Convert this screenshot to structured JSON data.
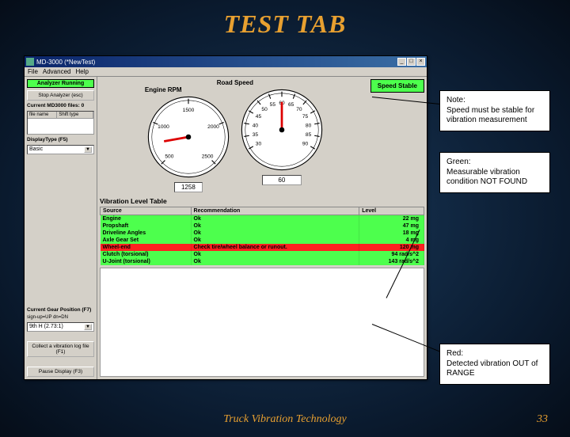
{
  "slide": {
    "title": "TEST TAB",
    "footer": "Truck Vibration Technology",
    "page": "33"
  },
  "window": {
    "title": "MD-3000 (*NewTest)",
    "menu": [
      "File",
      "Advanced",
      "Help"
    ],
    "winbtns": {
      "min": "_",
      "max": "□",
      "close": "×"
    }
  },
  "left": {
    "analyzer_status": "Analyzer Running",
    "stop_btn": "Stop Analyzer (esc)",
    "file_group": "Current MD3000 files: 0",
    "file_hdr_a": "file name",
    "file_hdr_b": "Shift type",
    "display_group": "DisplayType (F5)",
    "display_val": "Basic",
    "gear_group": "Current Gear Position (F7)",
    "gear_hint": "sign-up=UP dn=DN",
    "gear_val": "9th H (2.73:1)",
    "collect_btn": "Collect a vibration log file (F1)",
    "pause_btn": "Pause Display (F3)"
  },
  "gauges": {
    "road_speed_label": "Road Speed",
    "engine_rpm_label": "Engine RPM",
    "rpm_ticks": [
      "500",
      "1000",
      "1500",
      "2000",
      "2500"
    ],
    "speed_ticks": [
      "30",
      "35",
      "40",
      "45",
      "50",
      "55",
      "60",
      "65",
      "70",
      "75",
      "80",
      "85",
      "90"
    ],
    "rpm_value": "1258",
    "speed_value": "60",
    "speed_stable": "Speed Stable"
  },
  "table": {
    "title": "Vibration Level Table",
    "cols": [
      "Source",
      "Recommendation",
      "Level"
    ],
    "rows": [
      {
        "src": "Engine",
        "rec": "Ok",
        "lvl": "22 mg",
        "cls": "ok"
      },
      {
        "src": "Propshaft",
        "rec": "Ok",
        "lvl": "47 mg",
        "cls": "ok"
      },
      {
        "src": "Driveline Angles",
        "rec": "Ok",
        "lvl": "18 mg",
        "cls": "ok"
      },
      {
        "src": "Axle Gear Set",
        "rec": "Ok",
        "lvl": "4 mg",
        "cls": "ok"
      },
      {
        "src": "Wheel-end",
        "rec": "Check tire/wheel balance or runout.",
        "lvl": "120 mg",
        "cls": "bad"
      },
      {
        "src": "Clutch (torsional)",
        "rec": "Ok",
        "lvl": "94 rad/s^2",
        "cls": "ok"
      },
      {
        "src": "U-Joint (torsional)",
        "rec": "Ok",
        "lvl": "143 rad/s^2",
        "cls": "ok"
      }
    ]
  },
  "callouts": {
    "note": {
      "h": "Note:",
      "b": "Speed must be stable for vibration measurement"
    },
    "green": {
      "h": "Green:",
      "b": "Measurable vibration condition NOT FOUND"
    },
    "red": {
      "h": "Red:",
      "b": "Detected vibration OUT of RANGE"
    }
  }
}
